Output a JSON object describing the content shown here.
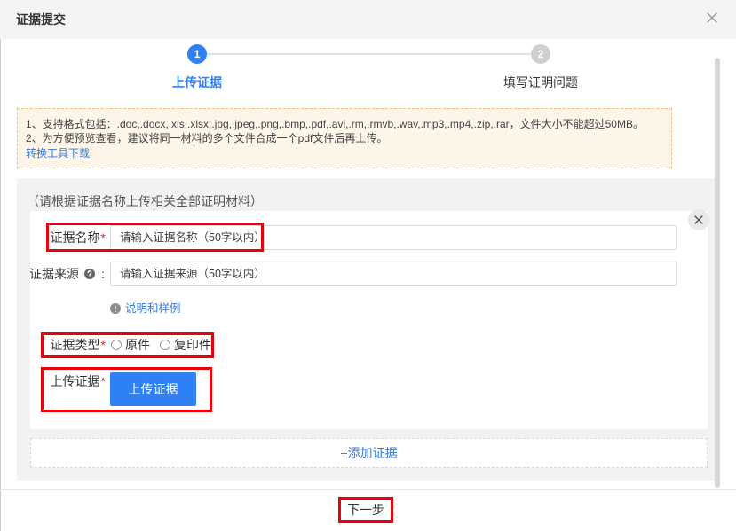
{
  "dialog": {
    "title": "证据提交"
  },
  "steps": [
    {
      "number": "1",
      "label": "上传证据",
      "active": true
    },
    {
      "number": "2",
      "label": "填写证明问题",
      "active": false
    }
  ],
  "notice": {
    "lines": [
      "1、支持格式包括：.doc,.docx,.xls,.xlsx,.jpg,.jpeg,.png,.bmp,.pdf,.avi,.rm,.rmvb,.wav,.mp3,.mp4,.zip,.rar，文件大小不能超过50MB。",
      "2、为方便预览查看，建议将同一材料的多个文件合成一个pdf文件后再上传。"
    ],
    "tool_link": "转换工具下载"
  },
  "evidence": {
    "hint": "（请根据证据名称上传相关全部证明材料）",
    "name_field": {
      "label": "证据名称",
      "required_mark": "*",
      "placeholder": "请输入证据名称（50字以内）"
    },
    "source_field": {
      "label": "证据来源",
      "colon": ":",
      "placeholder": "请输入证据来源（50字以内）"
    },
    "example_link": "说明和样例",
    "type_field": {
      "label": "证据类型",
      "required_mark": "*",
      "options": [
        {
          "label": "原件",
          "checked": false
        },
        {
          "label": "复印件",
          "checked": false
        }
      ]
    },
    "upload_field": {
      "label": "上传证据",
      "required_mark": "*",
      "button_label": "上传证据"
    },
    "add_button_label": "+添加证据"
  },
  "footer": {
    "next_button_label": "下一步"
  },
  "icons": {
    "dialog_close": "close-icon",
    "card_remove": "close-circle-icon",
    "source_help": "question-circle-icon",
    "example_info": "exclamation-circle-icon"
  },
  "colors": {
    "accent": "#2f80f5",
    "link": "#2f7ae5",
    "required": "#e02e2e",
    "annotation": "#e8000b",
    "notice_border": "#f3c27a",
    "notice_bg": "#fdf6e8",
    "section_bg": "#f2f2f2",
    "step_inactive": "#cfcfcf",
    "header_bg": "#f4f4f4"
  }
}
